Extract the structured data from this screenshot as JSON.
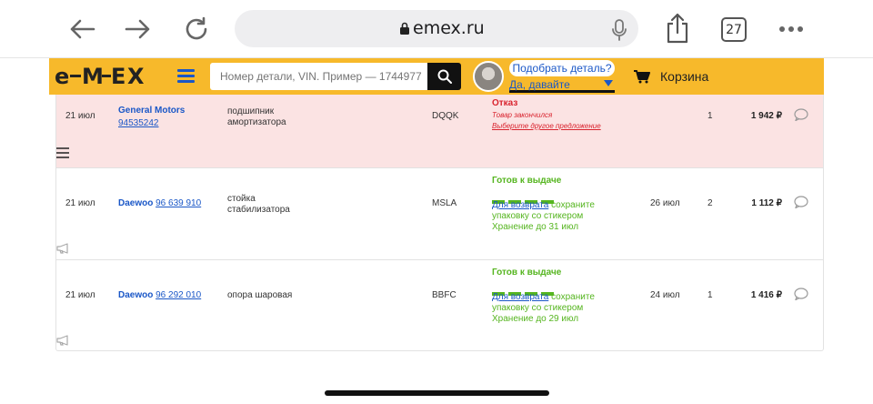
{
  "browser": {
    "url": "emex.ru",
    "tab_count": "27"
  },
  "header": {
    "logo": "EMEX",
    "search_placeholder": "Номер детали, VIN. Пример — 1744977",
    "pick_question": "Подобрать деталь?",
    "pick_answer": "Да, давайте",
    "cart_label": "Корзина",
    "accent_color": "#f7b92b",
    "link_color": "#1a57c7"
  },
  "orders": [
    {
      "date": "21 июл",
      "brand": "General Motors",
      "part_number": "94535242",
      "description_line1": "подшипник",
      "description_line2": "амортизатора",
      "supplier": "DQQK",
      "status": "Отказ",
      "status_note": "Товар закончился",
      "status_action": "Выберите другое предложение",
      "qty": "1",
      "price": "1 942 ₽",
      "status_color": "#d9232e"
    },
    {
      "date": "21 июл",
      "brand": "Daewoo",
      "part_number": "96 639 910",
      "description_line1": "стойка",
      "description_line2": "стабилизатора",
      "supplier": "MSLA",
      "status": "Готов к выдаче",
      "return_link": "Для возврата",
      "return_text_1": "сохраните",
      "return_text_2": "упаковку со стикером",
      "storage": "Хранение до 31 июл",
      "delivery_date": "26 июл",
      "qty": "2",
      "price": "1 112 ₽",
      "status_color": "#55b51f"
    },
    {
      "date": "21 июл",
      "brand": "Daewoo",
      "part_number": "96 292 010",
      "description_line1": "опора шаровая",
      "supplier": "BBFC",
      "status": "Готов к выдаче",
      "return_link": "Для возврата",
      "return_text_1": "сохраните",
      "return_text_2": "упаковку со стикером",
      "storage": "Хранение до 29 июл",
      "delivery_date": "24 июл",
      "qty": "1",
      "price": "1 416 ₽",
      "status_color": "#55b51f"
    }
  ]
}
